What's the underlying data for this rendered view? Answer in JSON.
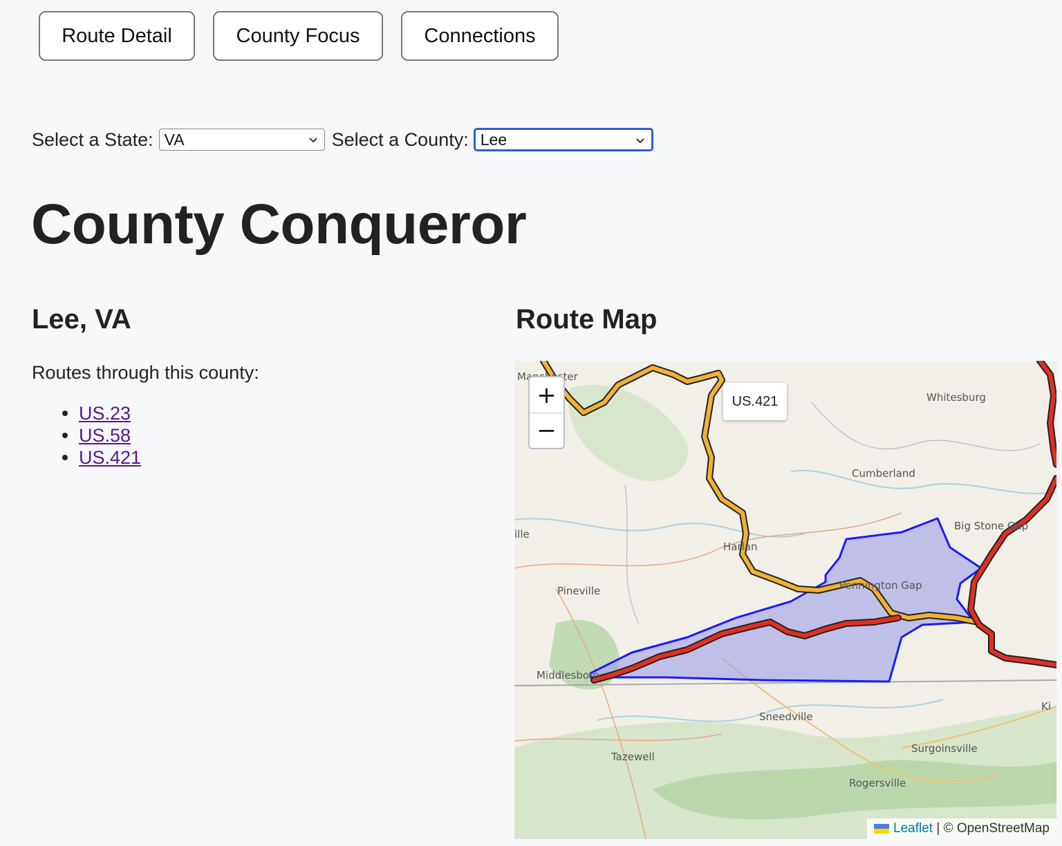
{
  "nav": {
    "buttons": [
      {
        "label": "Route Detail"
      },
      {
        "label": "County Focus"
      },
      {
        "label": "Connections"
      }
    ]
  },
  "selectors": {
    "state_label": "Select a State:",
    "state_value": "VA",
    "county_label": "Select a County:",
    "county_value": "Lee"
  },
  "page_title": "County Conqueror",
  "county": {
    "heading": "Lee, VA",
    "routes_label": "Routes through this county:",
    "routes": [
      "US.23",
      "US.58",
      "US.421"
    ]
  },
  "map": {
    "heading": "Route Map",
    "tooltip": "US.421",
    "zoom_in": "+",
    "zoom_out": "−",
    "attribution_link": "Leaflet",
    "attribution_sep": " | ",
    "attribution_text": "© OpenStreetMap",
    "places": {
      "manchester": "Manchester",
      "whitesburg": "Whitesburg",
      "cumberland": "Cumberland",
      "big_stone_gap": "Big Stone Gap",
      "harlan": "Harlan",
      "ille": "ille",
      "pineville": "Pineville",
      "pennington_gap": "Pennington Gap",
      "middlesboro": "Middlesboro",
      "sneedville": "Sneedville",
      "ki": "Ki",
      "surgoinsville": "Surgoinsville",
      "tazewell": "Tazewell",
      "rogersville": "Rogersville"
    },
    "colors": {
      "us421": "#f2b134",
      "us58": "#e03020",
      "us23": "#e03020",
      "county_fill": "#9f9fe8",
      "county_stroke": "#1a1aff"
    }
  }
}
